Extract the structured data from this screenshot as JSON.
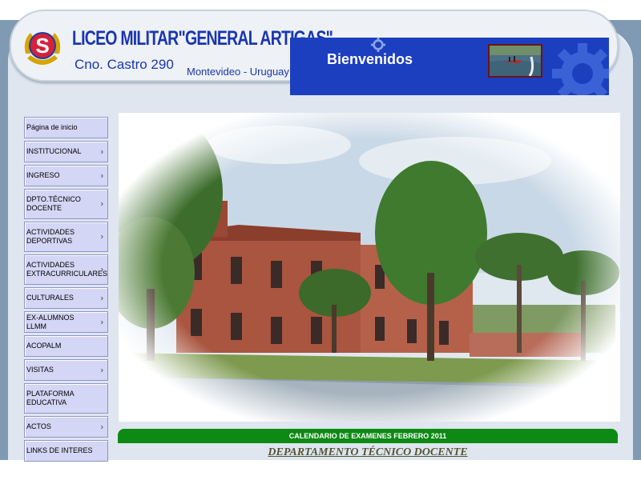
{
  "header": {
    "school_name": "LICEO MILITAR\"GENERAL ARTIGAS\"",
    "address": "Cno. Castro 290",
    "city": "Montevideo - Uruguay",
    "welcome": "Bienvenidos"
  },
  "sidebar": {
    "items": [
      {
        "label": "Página de inicio",
        "has_submenu": false
      },
      {
        "label": "INSTITUCIONAL",
        "has_submenu": true
      },
      {
        "label": "INGRESO",
        "has_submenu": true
      },
      {
        "label": "DPTO.TÉCNICO DOCENTE",
        "has_submenu": true
      },
      {
        "label": "ACTIVIDADES DEPORTIVAS",
        "has_submenu": true
      },
      {
        "label": "ACTIVIDADES EXTRACURRICULARES",
        "has_submenu": true
      },
      {
        "label": "CULTURALES",
        "has_submenu": true
      },
      {
        "label": "EX-ALUMNOS LLMM",
        "has_submenu": true
      },
      {
        "label": "ACOPALM",
        "has_submenu": false
      },
      {
        "label": "VISITAS",
        "has_submenu": true
      },
      {
        "label": "PLATAFORMA EDUCATIVA",
        "has_submenu": false
      },
      {
        "label": "ACTOS",
        "has_submenu": true
      },
      {
        "label": "LINKS DE INTERES",
        "has_submenu": false
      }
    ]
  },
  "main": {
    "calendar_label": "CALENDARIO DE EXAMENES FEBRERO 2011",
    "department_title": "DEPARTAMENTO TÉCNICO DOCENTE"
  },
  "colors": {
    "brand_blue": "#1c3fbf",
    "nav_bg": "#d3d6f4",
    "calendar_green": "#0c8a14"
  }
}
